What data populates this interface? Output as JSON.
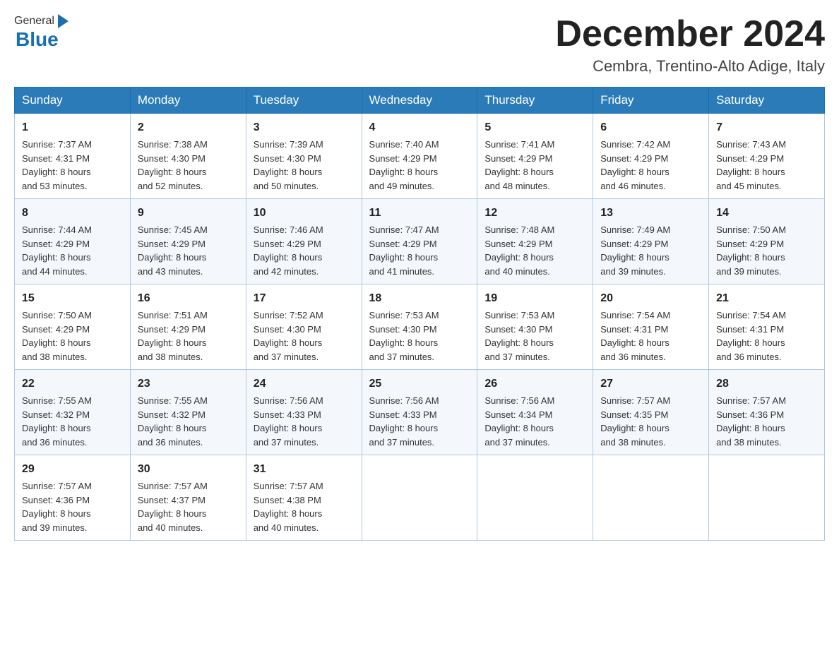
{
  "header": {
    "logo_general": "General",
    "logo_blue": "Blue",
    "month_title": "December 2024",
    "location": "Cembra, Trentino-Alto Adige, Italy"
  },
  "days_of_week": [
    "Sunday",
    "Monday",
    "Tuesday",
    "Wednesday",
    "Thursday",
    "Friday",
    "Saturday"
  ],
  "weeks": [
    [
      {
        "day": "1",
        "sunrise": "7:37 AM",
        "sunset": "4:31 PM",
        "daylight": "8 hours and 53 minutes."
      },
      {
        "day": "2",
        "sunrise": "7:38 AM",
        "sunset": "4:30 PM",
        "daylight": "8 hours and 52 minutes."
      },
      {
        "day": "3",
        "sunrise": "7:39 AM",
        "sunset": "4:30 PM",
        "daylight": "8 hours and 50 minutes."
      },
      {
        "day": "4",
        "sunrise": "7:40 AM",
        "sunset": "4:29 PM",
        "daylight": "8 hours and 49 minutes."
      },
      {
        "day": "5",
        "sunrise": "7:41 AM",
        "sunset": "4:29 PM",
        "daylight": "8 hours and 48 minutes."
      },
      {
        "day": "6",
        "sunrise": "7:42 AM",
        "sunset": "4:29 PM",
        "daylight": "8 hours and 46 minutes."
      },
      {
        "day": "7",
        "sunrise": "7:43 AM",
        "sunset": "4:29 PM",
        "daylight": "8 hours and 45 minutes."
      }
    ],
    [
      {
        "day": "8",
        "sunrise": "7:44 AM",
        "sunset": "4:29 PM",
        "daylight": "8 hours and 44 minutes."
      },
      {
        "day": "9",
        "sunrise": "7:45 AM",
        "sunset": "4:29 PM",
        "daylight": "8 hours and 43 minutes."
      },
      {
        "day": "10",
        "sunrise": "7:46 AM",
        "sunset": "4:29 PM",
        "daylight": "8 hours and 42 minutes."
      },
      {
        "day": "11",
        "sunrise": "7:47 AM",
        "sunset": "4:29 PM",
        "daylight": "8 hours and 41 minutes."
      },
      {
        "day": "12",
        "sunrise": "7:48 AM",
        "sunset": "4:29 PM",
        "daylight": "8 hours and 40 minutes."
      },
      {
        "day": "13",
        "sunrise": "7:49 AM",
        "sunset": "4:29 PM",
        "daylight": "8 hours and 39 minutes."
      },
      {
        "day": "14",
        "sunrise": "7:50 AM",
        "sunset": "4:29 PM",
        "daylight": "8 hours and 39 minutes."
      }
    ],
    [
      {
        "day": "15",
        "sunrise": "7:50 AM",
        "sunset": "4:29 PM",
        "daylight": "8 hours and 38 minutes."
      },
      {
        "day": "16",
        "sunrise": "7:51 AM",
        "sunset": "4:29 PM",
        "daylight": "8 hours and 38 minutes."
      },
      {
        "day": "17",
        "sunrise": "7:52 AM",
        "sunset": "4:30 PM",
        "daylight": "8 hours and 37 minutes."
      },
      {
        "day": "18",
        "sunrise": "7:53 AM",
        "sunset": "4:30 PM",
        "daylight": "8 hours and 37 minutes."
      },
      {
        "day": "19",
        "sunrise": "7:53 AM",
        "sunset": "4:30 PM",
        "daylight": "8 hours and 37 minutes."
      },
      {
        "day": "20",
        "sunrise": "7:54 AM",
        "sunset": "4:31 PM",
        "daylight": "8 hours and 36 minutes."
      },
      {
        "day": "21",
        "sunrise": "7:54 AM",
        "sunset": "4:31 PM",
        "daylight": "8 hours and 36 minutes."
      }
    ],
    [
      {
        "day": "22",
        "sunrise": "7:55 AM",
        "sunset": "4:32 PM",
        "daylight": "8 hours and 36 minutes."
      },
      {
        "day": "23",
        "sunrise": "7:55 AM",
        "sunset": "4:32 PM",
        "daylight": "8 hours and 36 minutes."
      },
      {
        "day": "24",
        "sunrise": "7:56 AM",
        "sunset": "4:33 PM",
        "daylight": "8 hours and 37 minutes."
      },
      {
        "day": "25",
        "sunrise": "7:56 AM",
        "sunset": "4:33 PM",
        "daylight": "8 hours and 37 minutes."
      },
      {
        "day": "26",
        "sunrise": "7:56 AM",
        "sunset": "4:34 PM",
        "daylight": "8 hours and 37 minutes."
      },
      {
        "day": "27",
        "sunrise": "7:57 AM",
        "sunset": "4:35 PM",
        "daylight": "8 hours and 38 minutes."
      },
      {
        "day": "28",
        "sunrise": "7:57 AM",
        "sunset": "4:36 PM",
        "daylight": "8 hours and 38 minutes."
      }
    ],
    [
      {
        "day": "29",
        "sunrise": "7:57 AM",
        "sunset": "4:36 PM",
        "daylight": "8 hours and 39 minutes."
      },
      {
        "day": "30",
        "sunrise": "7:57 AM",
        "sunset": "4:37 PM",
        "daylight": "8 hours and 40 minutes."
      },
      {
        "day": "31",
        "sunrise": "7:57 AM",
        "sunset": "4:38 PM",
        "daylight": "8 hours and 40 minutes."
      },
      null,
      null,
      null,
      null
    ]
  ],
  "labels": {
    "sunrise": "Sunrise:",
    "sunset": "Sunset:",
    "daylight": "Daylight:"
  }
}
